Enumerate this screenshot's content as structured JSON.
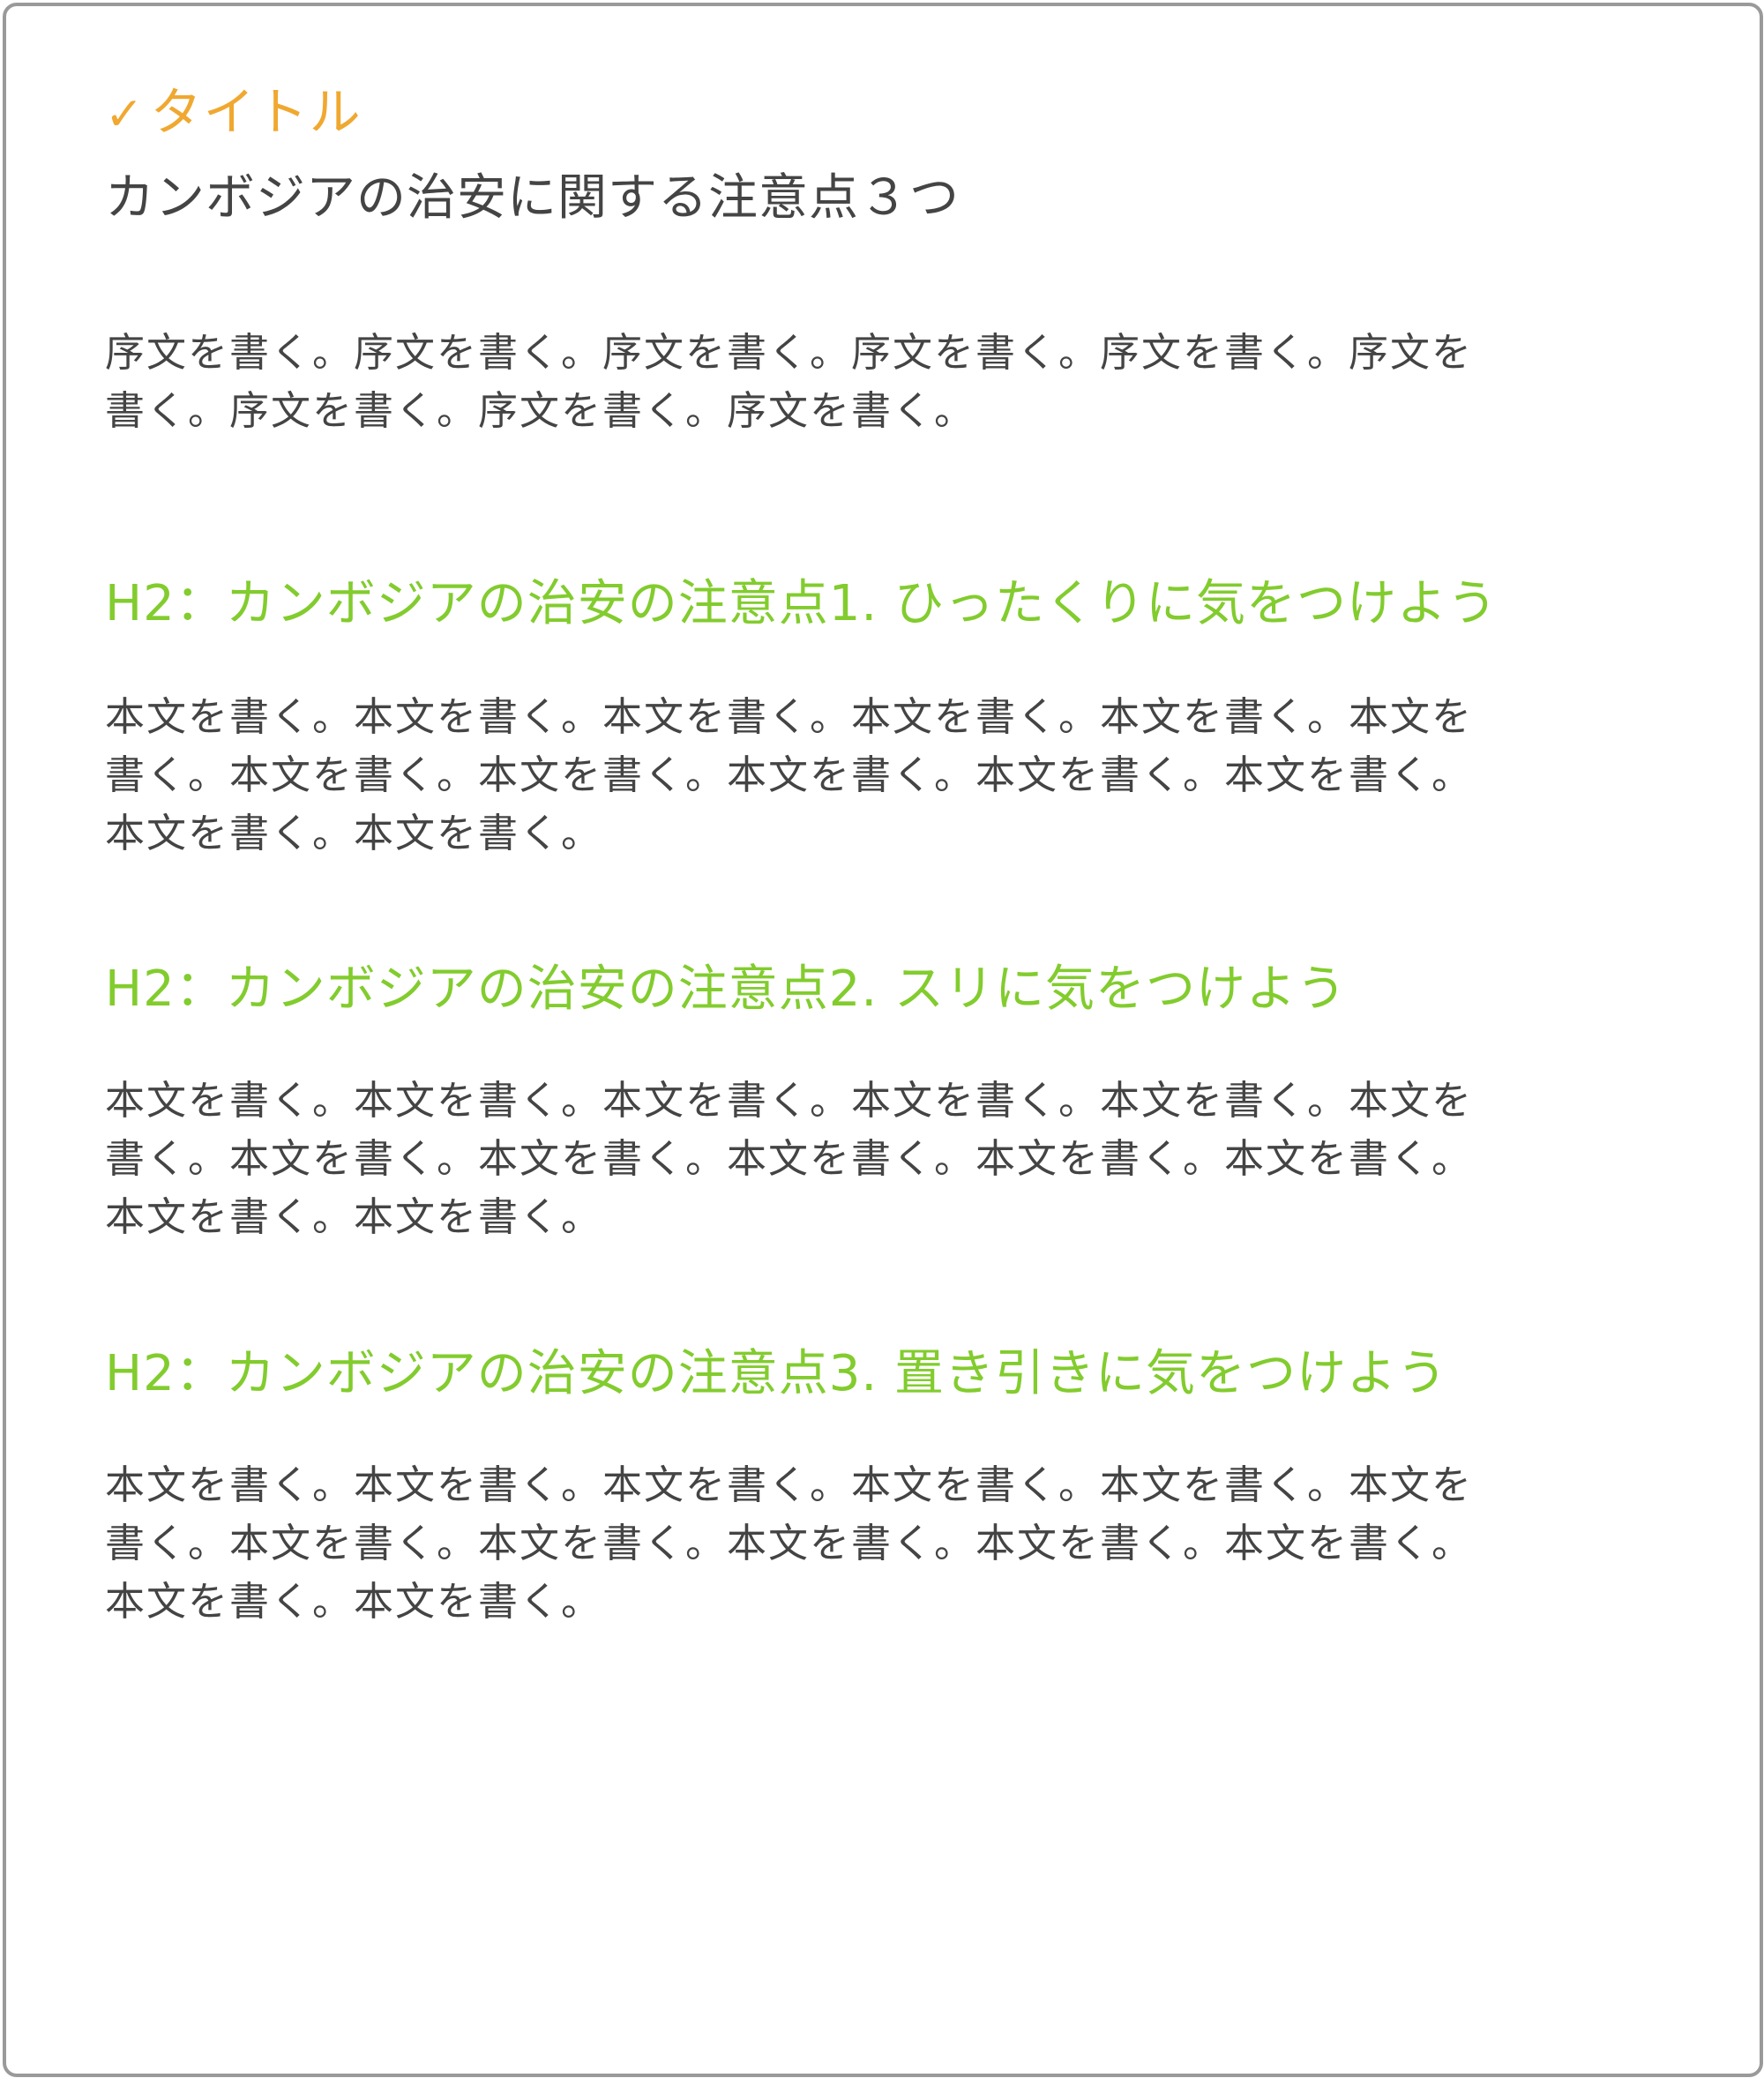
{
  "colors": {
    "label_accent": "#f0a830",
    "heading_green": "#82cc2e",
    "text_dark": "#444444",
    "frame_border": "#9a9a9a"
  },
  "label": {
    "check": "✓",
    "text": "タイトル"
  },
  "title": "カンボジアの治安に関する注意点３つ",
  "intro": {
    "lines": [
      "序文を書く。序文を書く。序文を書く。序文を書く。序文を書く。序文を",
      "書く。序文を書く。序文を書く。序文を書く。"
    ]
  },
  "sections": [
    {
      "heading": "H2：カンボジアの治安の注意点1. ひったくりに気をつけよう",
      "lines": [
        "本文を書く。本文を書く。本文を書く。本文を書く。本文を書く。本文を",
        "書く。本文を書く。本文を書く。本文を書く。本文を書く。本文を書く。",
        "本文を書く。本文を書く。"
      ]
    },
    {
      "heading": "H2：カンボジアの治安の注意点2. スリに気をつけよう",
      "lines": [
        "本文を書く。本文を書く。本文を書く。本文を書く。本文を書く。本文を",
        "書く。本文を書く。本文を書く。本文を書く。本文を書く。本文を書く。",
        "本文を書く。本文を書く。"
      ]
    },
    {
      "heading": "H2：カンボジアの治安の注意点3. 置き引きに気をつけよう",
      "lines": [
        "本文を書く。本文を書く。本文を書く。本文を書く。本文を書く。本文を",
        "書く。本文を書く。本文を書く。本文を書く。本文を書く。本文を書く。",
        "本文を書く。本文を書く。"
      ]
    }
  ]
}
